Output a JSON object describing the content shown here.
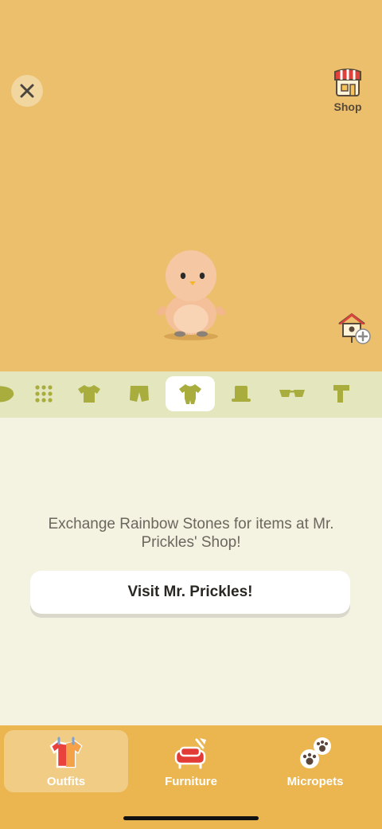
{
  "header": {
    "close_icon": "close-icon",
    "shop_label": "Shop",
    "shop_icon": "shop-icon",
    "add_home_icon": "house-add-icon"
  },
  "category_tabs": [
    {
      "name": "leaf",
      "icon": "leaf-icon",
      "active": false
    },
    {
      "name": "all",
      "icon": "grid-icon",
      "active": false
    },
    {
      "name": "tops",
      "icon": "shirt-icon",
      "active": false
    },
    {
      "name": "bottoms",
      "icon": "shorts-icon",
      "active": false
    },
    {
      "name": "onesies",
      "icon": "onesie-icon",
      "active": true
    },
    {
      "name": "hats",
      "icon": "hat-icon",
      "active": false
    },
    {
      "name": "glasses",
      "icon": "glasses-icon",
      "active": false
    },
    {
      "name": "scarves",
      "icon": "scarf-icon",
      "active": false
    }
  ],
  "empty_state": {
    "message": "Exchange Rainbow Stones for items at Mr. Prickles' Shop!",
    "button_label": "Visit Mr. Prickles!"
  },
  "bottom_nav": {
    "items": [
      {
        "label": "Outfits",
        "icon": "outfits-icon",
        "active": true
      },
      {
        "label": "Furniture",
        "icon": "furniture-icon",
        "active": false
      },
      {
        "label": "Micropets",
        "icon": "micropets-icon",
        "active": false
      }
    ]
  },
  "colors": {
    "hero_bg": "#ebbf6c",
    "tab_strip_bg": "#e4e6bd",
    "tab_icon": "#a8ad3e",
    "content_bg": "#f4f2e0",
    "nav_bg": "#ebb54f"
  }
}
